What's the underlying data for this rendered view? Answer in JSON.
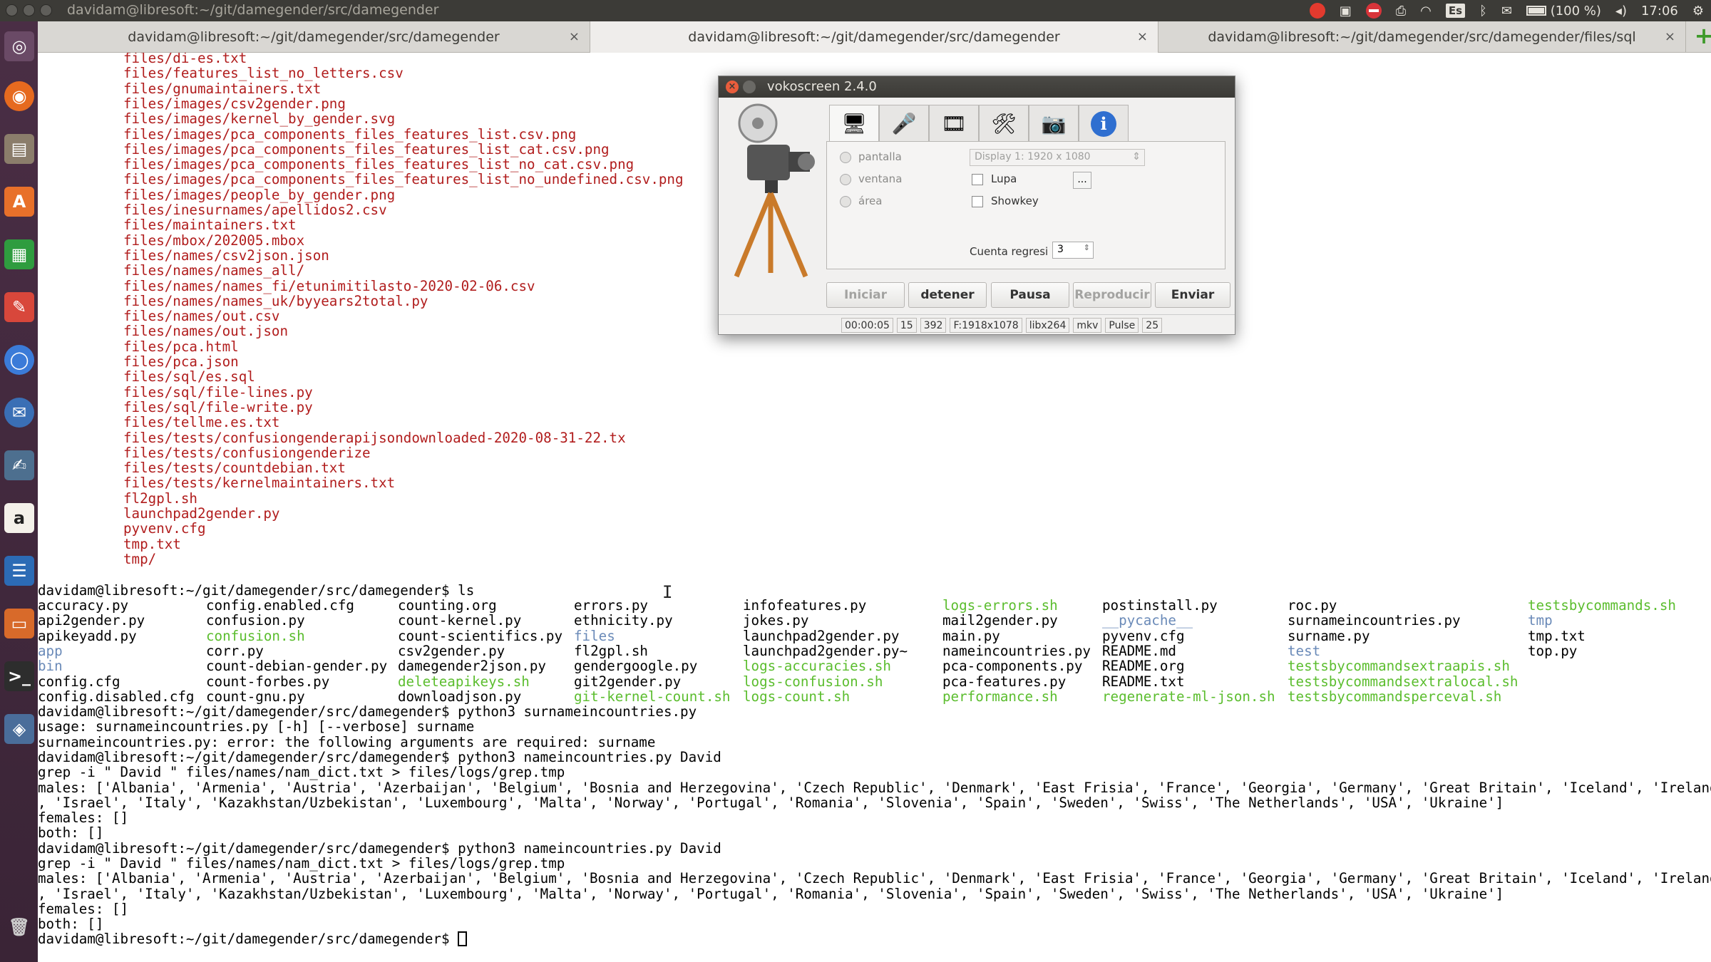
{
  "topbar": {
    "window_title": "davidam@libresoft:~/git/damegender/src/damegender",
    "tray": {
      "keyboard": "Es",
      "battery": "(100 %)",
      "time": "17:06"
    }
  },
  "launcher": {
    "items": [
      "ubuntu-dash",
      "firefox",
      "files",
      "software-center",
      "calc",
      "settings",
      "chromium",
      "thunderbird",
      "editor",
      "amazon",
      "writer",
      "impress",
      "terminal",
      "system-monitor",
      "trash"
    ]
  },
  "tabs": [
    {
      "label": "davidam@libresoft:~/git/damegender/src/damegender",
      "close": "×"
    },
    {
      "label": "davidam@libresoft:~/git/damegender/src/damegender",
      "close": "×"
    },
    {
      "label": "davidam@libresoft:~/git/damegender/src/damegender/files/sql",
      "close": "×"
    }
  ],
  "terminal": {
    "file_lines": [
      "files/di-es.txt",
      "files/features_list_no_letters.csv",
      "files/gnumaintainers.txt",
      "files/images/csv2gender.png",
      "files/images/kernel_by_gender.svg",
      "files/images/pca_components_files_features_list.csv.png",
      "files/images/pca_components_files_features_list_cat.csv.png",
      "files/images/pca_components_files_features_list_no_cat.csv.png",
      "files/images/pca_components_files_features_list_no_undefined.csv.png",
      "files/images/people_by_gender.png",
      "files/inesurnames/apellidos2.csv",
      "files/maintainers.txt",
      "files/mbox/202005.mbox",
      "files/names/csv2json.json",
      "files/names/names_all/",
      "files/names/names_fi/etunimitilasto-2020-02-06.csv",
      "files/names/names_uk/byyears2total.py",
      "files/names/out.csv",
      "files/names/out.json",
      "files/pca.html",
      "files/pca.json",
      "files/sql/es.sql",
      "files/sql/file-lines.py",
      "files/sql/file-write.py",
      "files/tellme.es.txt",
      "files/tests/confusiongenderapijsondownloaded-2020-08-31-22.tx",
      "files/tests/confusiongenderize",
      "files/tests/countdebian.txt",
      "files/tests/kernelmaintainers.txt",
      "fl2gpl.sh",
      "launchpad2gender.py",
      "pyvenv.cfg",
      "tmp.txt",
      "tmp/"
    ],
    "prompt_ls": "davidam@libresoft:~/git/damegender/src/damegender$ ls",
    "ls_columns": [
      [
        [
          "accuracy.py",
          "n"
        ],
        [
          "api2gender.py",
          "n"
        ],
        [
          "apikeyadd.py",
          "n"
        ],
        [
          "app",
          "b"
        ],
        [
          "bin",
          "b"
        ],
        [
          "config.cfg",
          "n"
        ],
        [
          "config.disabled.cfg",
          "n"
        ]
      ],
      [
        [
          "config.enabled.cfg",
          "n"
        ],
        [
          "confusion.py",
          "n"
        ],
        [
          "confusion.sh",
          "g"
        ],
        [
          "corr.py",
          "n"
        ],
        [
          "count-debian-gender.py",
          "n"
        ],
        [
          "count-forbes.py",
          "n"
        ],
        [
          "count-gnu.py",
          "n"
        ]
      ],
      [
        [
          "counting.org",
          "n"
        ],
        [
          "count-kernel.py",
          "n"
        ],
        [
          "count-scientifics.py",
          "n"
        ],
        [
          "csv2gender.py",
          "n"
        ],
        [
          "damegender2json.py",
          "n"
        ],
        [
          "deleteapikeys.sh",
          "g"
        ],
        [
          "downloadjson.py",
          "n"
        ]
      ],
      [
        [
          "errors.py",
          "n"
        ],
        [
          "ethnicity.py",
          "n"
        ],
        [
          "files",
          "b"
        ],
        [
          "fl2gpl.sh",
          "n"
        ],
        [
          "gendergoogle.py",
          "n"
        ],
        [
          "git2gender.py",
          "n"
        ],
        [
          "git-kernel-count.sh",
          "g"
        ]
      ],
      [
        [
          "infofeatures.py",
          "n"
        ],
        [
          "jokes.py",
          "n"
        ],
        [
          "launchpad2gender.py",
          "n"
        ],
        [
          "launchpad2gender.py~",
          "n"
        ],
        [
          "logs-accuracies.sh",
          "g"
        ],
        [
          "logs-confusion.sh",
          "g"
        ],
        [
          "logs-count.sh",
          "g"
        ]
      ],
      [
        [
          "logs-errors.sh",
          "g"
        ],
        [
          "mail2gender.py",
          "n"
        ],
        [
          "main.py",
          "n"
        ],
        [
          "nameincountries.py",
          "n"
        ],
        [
          "pca-components.py",
          "n"
        ],
        [
          "pca-features.py",
          "n"
        ],
        [
          "performance.sh",
          "g"
        ]
      ],
      [
        [
          "postinstall.py",
          "n"
        ],
        [
          "__pycache__",
          "b"
        ],
        [
          "pyvenv.cfg",
          "n"
        ],
        [
          "README.md",
          "n"
        ],
        [
          "README.org",
          "n"
        ],
        [
          "README.txt",
          "n"
        ],
        [
          "regenerate-ml-json.sh",
          "g"
        ]
      ],
      [
        [
          "roc.py",
          "n"
        ],
        [
          "surnameincountries.py",
          "n"
        ],
        [
          "surname.py",
          "n"
        ],
        [
          "test",
          "b"
        ],
        [
          "testsbycommandsextraapis.sh",
          "g"
        ],
        [
          "testsbycommandsextralocal.sh",
          "g"
        ],
        [
          "testsbycommandsperceval.sh",
          "g"
        ]
      ],
      [
        [
          "testsbycommands.sh",
          "g"
        ],
        [
          "tmp",
          "b"
        ],
        [
          "tmp.txt",
          "n"
        ],
        [
          "top.py",
          "n"
        ]
      ]
    ],
    "tail_lines": [
      "davidam@libresoft:~/git/damegender/src/damegender$ python3 surnameincountries.py",
      "usage: surnameincountries.py [-h] [--verbose] surname",
      "surnameincountries.py: error: the following arguments are required: surname",
      "davidam@libresoft:~/git/damegender/src/damegender$ python3 nameincountries.py David",
      "grep -i \" David \" files/names/nam_dict.txt > files/logs/grep.tmp",
      "males: ['Albania', 'Armenia', 'Austria', 'Azerbaijan', 'Belgium', 'Bosnia and Herzegovina', 'Czech Republic', 'Denmark', 'East Frisia', 'France', 'Georgia', 'Germany', 'Great Britain', 'Iceland', 'Ireland",
      ", 'Israel', 'Italy', 'Kazakhstan/Uzbekistan', 'Luxembourg', 'Malta', 'Norway', 'Portugal', 'Romania', 'Slovenia', 'Spain', 'Sweden', 'Swiss', 'The Netherlands', 'USA', 'Ukraine']",
      "females: []",
      "both: []",
      "davidam@libresoft:~/git/damegender/src/damegender$ python3 nameincountries.py David",
      "grep -i \" David \" files/names/nam_dict.txt > files/logs/grep.tmp",
      "males: ['Albania', 'Armenia', 'Austria', 'Azerbaijan', 'Belgium', 'Bosnia and Herzegovina', 'Czech Republic', 'Denmark', 'East Frisia', 'France', 'Georgia', 'Germany', 'Great Britain', 'Iceland', 'Ireland",
      ", 'Israel', 'Italy', 'Kazakhstan/Uzbekistan', 'Luxembourg', 'Malta', 'Norway', 'Portugal', 'Romania', 'Slovenia', 'Spain', 'Sweden', 'Swiss', 'The Netherlands', 'USA', 'Ukraine']",
      "females: []",
      "both: []"
    ],
    "final_prompt": "davidam@libresoft:~/git/damegender/src/damegender$ "
  },
  "vokoscreen": {
    "title": "vokoscreen 2.4.0",
    "close_glyph": "×",
    "tabs": [
      "screen-icon",
      "microphone-icon",
      "video-file-icon",
      "tools-icon",
      "webcam-icon",
      "info-icon"
    ],
    "modes": [
      "pantalla",
      "ventana",
      "área"
    ],
    "display_combo": "Display 1:  1920 x 1080",
    "lupa_label": "Lupa",
    "showkey_label": "Showkey",
    "dots_label": "...",
    "countdown_label": "Cuenta regresi",
    "countdown_value": "3",
    "buttons": {
      "iniciar": "Iniciar",
      "detener": "detener",
      "pausa": "Pausa",
      "reproducir": "Reproducir",
      "enviar": "Enviar"
    },
    "status": [
      "00:00:05",
      "15",
      "392",
      "F:1918x1078",
      "libx264",
      "mkv",
      "Pulse",
      "25"
    ]
  }
}
